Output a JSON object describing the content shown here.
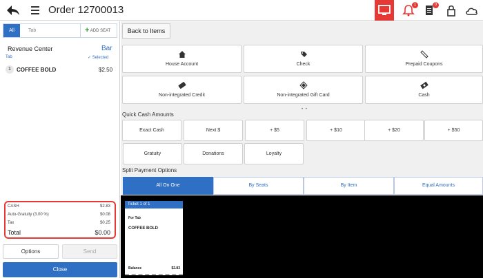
{
  "header": {
    "title": "Order 12700013",
    "notification_count": "1",
    "orders_count": "0"
  },
  "left_panel": {
    "tab_all": "All",
    "tab_placeholder": "Tab",
    "add_seat": "ADD SEAT",
    "revenue_center_label": "Revenue Center",
    "revenue_center_value": "Bar",
    "tab_sub": "Tab",
    "selected_sub": "Selected",
    "items": [
      {
        "qty": "1",
        "name": "COFFEE BOLD",
        "price": "$2.50"
      }
    ],
    "totals": [
      {
        "label": "CASH",
        "value": "$2.83"
      },
      {
        "label": "Auto-Gratuity (3.00 %)",
        "value": "$0.08"
      },
      {
        "label": "Tax",
        "value": "$0.25"
      }
    ],
    "total_label": "Total",
    "total_value": "$0.00",
    "options_label": "Options",
    "send_label": "Send",
    "close_label": "Close"
  },
  "right_panel": {
    "back_to_items": "Back to Items",
    "payment_methods": [
      {
        "label": "House Account",
        "icon": "house-icon"
      },
      {
        "label": "Check",
        "icon": "check-tag-icon"
      },
      {
        "label": "Prepaid Coupons",
        "icon": "coupon-icon"
      },
      {
        "label": "Non-integrated Credit",
        "icon": "credit-card-icon"
      },
      {
        "label": "Non-integrated Gift Card",
        "icon": "gift-card-icon"
      },
      {
        "label": "Cash",
        "icon": "cash-icon"
      }
    ],
    "page_indicator": "• •",
    "quick_cash_title": "Quick Cash Amounts",
    "quick_cash": [
      "Exact Cash",
      "Next $",
      "+ $5",
      "+ $10",
      "+ $20",
      "+ $50"
    ],
    "extras": [
      "Gratuity",
      "Donations",
      "Loyalty"
    ],
    "split_title": "Split Payment Options",
    "split_options": [
      "All On One",
      "By Seats",
      "By Item",
      "Equal Amounts"
    ],
    "active_split": "All On One",
    "ticket": {
      "header": "Ticket 1 of 1",
      "for": "For Tab",
      "item": "COFFEE BOLD",
      "balance_label": "Balance",
      "balance_value": "$2.83"
    }
  },
  "colors": {
    "accent": "#2f6fc4",
    "alert": "#e53935"
  }
}
